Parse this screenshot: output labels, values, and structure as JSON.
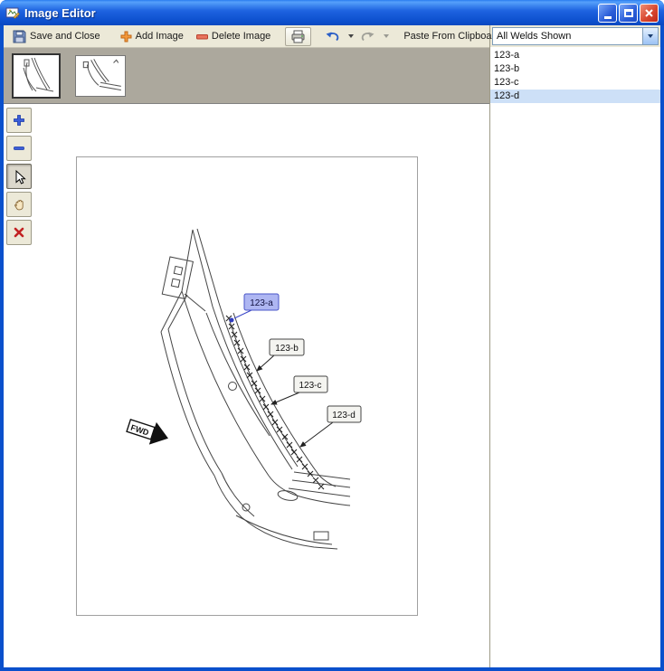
{
  "window": {
    "title": "Image Editor"
  },
  "titlebar": {
    "buttons": [
      "minimize-icon",
      "maximize-icon",
      "close-icon"
    ]
  },
  "toolbar": {
    "save_and_close": "Save and Close",
    "add_image": "Add Image",
    "delete_image": "Delete Image",
    "paste_from_clipboard": "Paste From Clipboard",
    "icons": {
      "save": "save-icon",
      "add": "plus-icon",
      "delete": "minus-icon",
      "print": "printer-icon",
      "undo": "undo-icon",
      "redo": "redo-icon"
    },
    "redo_enabled": false
  },
  "weld_filter": {
    "value": "All Welds Shown"
  },
  "weld_list": {
    "items": [
      {
        "label": "123-a",
        "selected": false
      },
      {
        "label": "123-b",
        "selected": false
      },
      {
        "label": "123-c",
        "selected": false
      },
      {
        "label": "123-d",
        "selected": true
      }
    ]
  },
  "thumbnails": {
    "count": 2,
    "selected_index": 0
  },
  "side_tools": [
    {
      "name": "zoom-in",
      "icon": "plus-icon",
      "active": false
    },
    {
      "name": "zoom-out",
      "icon": "minus-icon",
      "active": false
    },
    {
      "name": "select",
      "icon": "cursor-icon",
      "active": true
    },
    {
      "name": "pan",
      "icon": "hand-icon",
      "active": false
    },
    {
      "name": "delete",
      "icon": "red-x-icon",
      "active": false
    }
  ],
  "drawing": {
    "labels": [
      {
        "text": "123-a",
        "highlighted": true
      },
      {
        "text": "123-b",
        "highlighted": false
      },
      {
        "text": "123-c",
        "highlighted": false
      },
      {
        "text": "123-d",
        "highlighted": false
      }
    ],
    "direction_arrow": "FWD"
  },
  "colors": {
    "titlebar_blue": "#0A50CC",
    "toolbar_bg": "#ECE9D8",
    "thumbstrip_bg": "#ACA89D",
    "selected_row": "#CDE0F7",
    "weld_label_highlight_fill": "#AEB6F2",
    "weld_label_highlight_border": "#4A55C8"
  }
}
